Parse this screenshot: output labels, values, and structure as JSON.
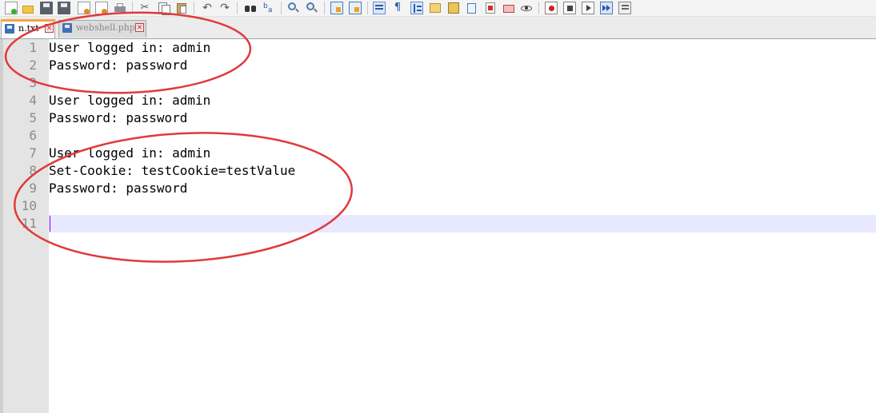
{
  "toolbar": {
    "buttons": [
      "new-file-icon",
      "open-file-icon",
      "save-icon",
      "save-all-icon",
      "close-icon",
      "close-all-icon",
      "print-icon",
      "cut-icon",
      "copy-icon",
      "paste-icon",
      "undo-icon",
      "redo-icon",
      "find-icon",
      "replace-icon",
      "zoom-in-icon",
      "zoom-out-icon",
      "sync-vertical-icon",
      "sync-horizontal-icon",
      "word-wrap-icon",
      "show-all-chars-icon",
      "indent-guide-icon",
      "doc-map-icon",
      "function-list-icon",
      "folder-workspace-icon",
      "monitoring-icon",
      "panel-icon",
      "eye-icon",
      "record-macro-icon",
      "stop-macro-icon",
      "play-macro-icon",
      "run-macro-multiple-icon",
      "save-macro-icon"
    ]
  },
  "tabs": [
    {
      "label": "n.txt",
      "active": true
    },
    {
      "label": "webshell.php",
      "active": false
    }
  ],
  "editor": {
    "line_numbers": [
      "1",
      "2",
      "3",
      "4",
      "5",
      "6",
      "7",
      "8",
      "9",
      "10",
      "11"
    ],
    "lines": [
      "User logged in: admin",
      "Password: password",
      "",
      "User logged in: admin",
      "Password: password",
      "",
      "User logged in: admin",
      "Set-Cookie: testCookie=testValue",
      "Password: password",
      "",
      ""
    ],
    "current_line": 11
  },
  "colors": {
    "annotation": "#e03a3a",
    "current_line": "#e8e8ff",
    "caret": "#8000ff",
    "tab_accent": "#f6a441"
  }
}
